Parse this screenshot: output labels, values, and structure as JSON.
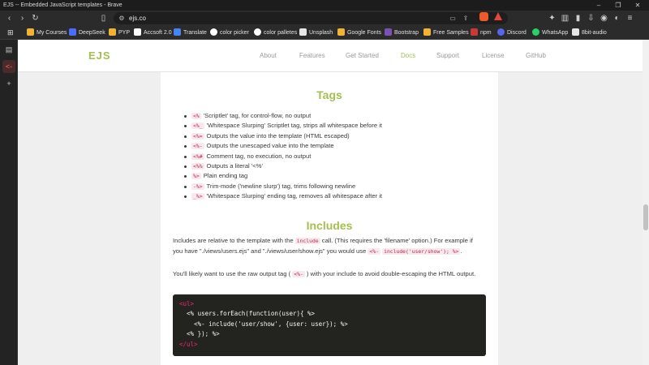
{
  "window": {
    "title": "EJS -- Embedded JavaScript templates - Brave"
  },
  "toolbar": {
    "url": "ejs.co"
  },
  "bookmarks": [
    {
      "label": "My Courses",
      "icon": "courses-icon",
      "color": "#f2b233"
    },
    {
      "label": "DeepSeek",
      "icon": "deepseek-icon",
      "color": "#4d6bfe"
    },
    {
      "label": "PYP",
      "icon": "pyp-icon",
      "color": "#f2b233"
    },
    {
      "label": "Accsoft 2.0",
      "icon": "accsoft-icon",
      "color": "#ffffff"
    },
    {
      "label": "Translate",
      "icon": "translate-icon",
      "color": "#4285f4"
    },
    {
      "label": "color picker",
      "icon": "google-icon",
      "color": "#ffffff"
    },
    {
      "label": "color palletes",
      "icon": "coolors-icon",
      "color": "#ffffff"
    },
    {
      "label": "Unsplash",
      "icon": "unsplash-icon",
      "color": "#e6e6e6"
    },
    {
      "label": "Google Fonts",
      "icon": "google-fonts-icon",
      "color": "#f2b233"
    },
    {
      "label": "Bootstrap",
      "icon": "bootstrap-icon",
      "color": "#7952b3"
    },
    {
      "label": "Free Samples",
      "icon": "free-samples-icon",
      "color": "#f2b233"
    },
    {
      "label": "npm",
      "icon": "npm-icon",
      "color": "#cb3837"
    },
    {
      "label": "Discord",
      "icon": "discord-icon",
      "color": "#5865f2"
    },
    {
      "label": "WhatsApp",
      "icon": "whatsapp-icon",
      "color": "#25d366"
    },
    {
      "label": "8bit-audio",
      "icon": "audio-icon",
      "color": "#e6e6e6"
    }
  ],
  "site": {
    "logo": "EJS",
    "nav": [
      {
        "label": "About",
        "active": false
      },
      {
        "label": "Features",
        "active": false
      },
      {
        "label": "Get Started",
        "active": false
      },
      {
        "label": "Docs",
        "active": true
      },
      {
        "label": "Support",
        "active": false
      },
      {
        "label": "License",
        "active": false
      },
      {
        "label": "GitHub",
        "active": false
      }
    ],
    "accent": "#a3bf4d"
  },
  "content": {
    "tags_heading": "Tags",
    "tags": [
      {
        "token": "<%",
        "desc": "'Scriptlet' tag, for control-flow, no output"
      },
      {
        "token": "<%_",
        "desc": "'Whitespace Slurping' Scriptlet tag, strips all whitespace before it"
      },
      {
        "token": "<%=",
        "desc": "Outputs the value into the template (HTML escaped)"
      },
      {
        "token": "<%-",
        "desc": "Outputs the unescaped value into the template"
      },
      {
        "token": "<%#",
        "desc": "Comment tag, no execution, no output"
      },
      {
        "token": "<%%",
        "desc": "Outputs a literal '<%'"
      },
      {
        "token": "%>",
        "desc": "Plain ending tag"
      },
      {
        "token": "-%>",
        "desc": "Trim-mode ('newline slurp') tag, trims following newline"
      },
      {
        "token": "_%>",
        "desc": "'Whitespace Slurping' ending tag, removes all whitespace after it"
      }
    ],
    "includes_heading": "Includes",
    "para1": {
      "t1": "Includes are relative to the template with the",
      "c1": "include",
      "t2": "call. (This requires the 'filename' option.) For",
      "t3": "example if you have \"./views/users.ejs\" and \"./views/user/show.ejs\" you would use",
      "c2": "<%-",
      "c3": "include('user/show'); %>",
      "t4": "."
    },
    "para2": {
      "t1": "You'll likely want to use the raw output tag (",
      "c1": "<%-",
      "t2": ") with your include to avoid double-escaping the HTML",
      "t3": "output."
    },
    "code": [
      {
        "pre": "",
        "tag": "<ul>",
        "rest": ""
      },
      {
        "pre": "  ",
        "tag": "",
        "rest": "<% users.forEach(function(user){ %>"
      },
      {
        "pre": "    ",
        "tag": "",
        "rest": "<%- include('user/show', {user: user}); %>"
      },
      {
        "pre": "  ",
        "tag": "",
        "rest": "<% }); %>"
      },
      {
        "pre": "",
        "tag": "</ul>",
        "rest": ""
      }
    ]
  }
}
